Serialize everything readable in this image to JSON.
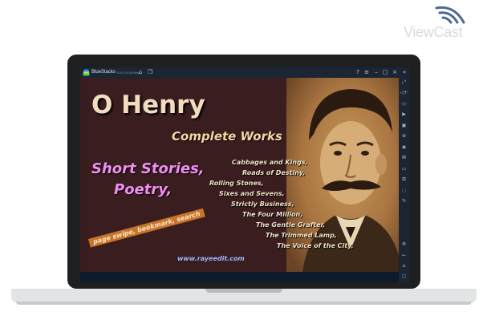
{
  "brand": {
    "name": "ViewCast"
  },
  "emulator": {
    "title": "BlueStacks",
    "version": "5.6.0.1028 Beta",
    "titlebar_icons": [
      "help-icon",
      "menu-icon",
      "minimize-icon",
      "maximize-icon",
      "close-icon",
      "collapse-sidebar-icon"
    ],
    "sidebar_icons": [
      "fullscreen-icon",
      "volume-up-icon",
      "volume-down-icon",
      "media-icon",
      "screenshot-icon",
      "install-apk-icon",
      "camera-icon",
      "macro-icon",
      "folder-icon",
      "multi-instance-icon",
      "eco-mode-icon",
      "rotate-icon",
      "settings-icon",
      "back-icon",
      "home-icon",
      "recents-icon"
    ]
  },
  "app": {
    "title": "O Henry",
    "subtitle": "Complete Works",
    "genres": [
      "Short Stories,",
      "Poetry,"
    ],
    "works": [
      "Cabbages and Kings,",
      "Roads of Destiny,",
      "Rolling Stones,",
      "Sixes and Sevens,",
      "Strictly Business,",
      "The Four Million,",
      "The Gentle Grafter,",
      "The Trimmed Lamp,",
      "The Voice of the City."
    ],
    "banner": "page swipe, bookmark, search",
    "url": "www.rayeedit.com"
  },
  "colors": {
    "app_background": "#3a1d1f",
    "title": "#f1dcc0",
    "subtitle": "#f3d7a3",
    "genres": "#ef8ff0",
    "banner": "#c8742b",
    "url": "#9cb8ff",
    "emulator_chrome": "#1b2534",
    "laptop_bezel": "#1d1f21"
  }
}
